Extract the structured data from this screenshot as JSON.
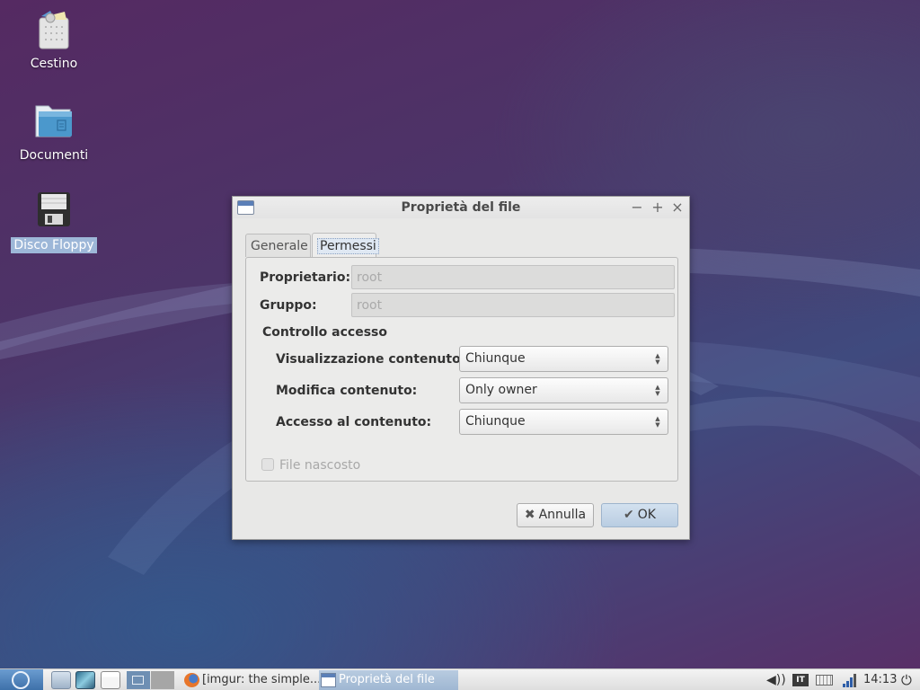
{
  "desktop": {
    "icons": [
      {
        "label": "Cestino",
        "icon": "trash-icon",
        "selected": false
      },
      {
        "label": "Documenti",
        "icon": "folder-icon",
        "selected": false
      },
      {
        "label": "Disco Floppy",
        "icon": "floppy-icon",
        "selected": true
      }
    ]
  },
  "dialog": {
    "title": "Proprietà del file",
    "controls": {
      "minimize": "−",
      "maximize": "+",
      "close": "×"
    },
    "tabs": [
      {
        "label": "Generale",
        "active": false
      },
      {
        "label": "Permessi",
        "active": true
      }
    ],
    "owner": {
      "label": "Proprietario:",
      "value": "root"
    },
    "group": {
      "label": "Gruppo:",
      "value": "root"
    },
    "access_section": "Controllo accesso",
    "access": [
      {
        "label": "Visualizzazione contenuto:",
        "value": "Chiunque"
      },
      {
        "label": "Modifica contenuto:",
        "value": "Only owner"
      },
      {
        "label": "Accesso al contenuto:",
        "value": "Chiunque"
      }
    ],
    "hidden_file": {
      "label": "File nascosto",
      "checked": false,
      "enabled": false
    },
    "buttons": {
      "cancel": "Annulla",
      "ok": "OK",
      "cancel_glyph": "✖",
      "ok_glyph": "✔"
    }
  },
  "taskbar": {
    "tasks": [
      {
        "label": "[imgur: the simple...",
        "icon": "firefox-icon",
        "active": false
      },
      {
        "label": "Proprietà del file",
        "icon": "window-icon",
        "active": true
      }
    ],
    "tray": {
      "keyboard_layout": "IT",
      "clock": "14:13"
    }
  }
}
